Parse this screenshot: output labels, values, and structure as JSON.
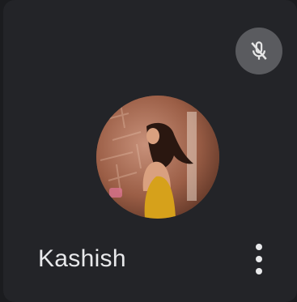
{
  "participant": {
    "name": "Kashish",
    "mic_state": "muted"
  },
  "icons": {
    "mic": "mic-off-icon",
    "more": "more-vert-icon"
  },
  "colors": {
    "tile_background": "#232428",
    "page_background": "#1b1c1f",
    "mute_button": "#5a5b5f",
    "name_text": "#e8e9eb"
  }
}
